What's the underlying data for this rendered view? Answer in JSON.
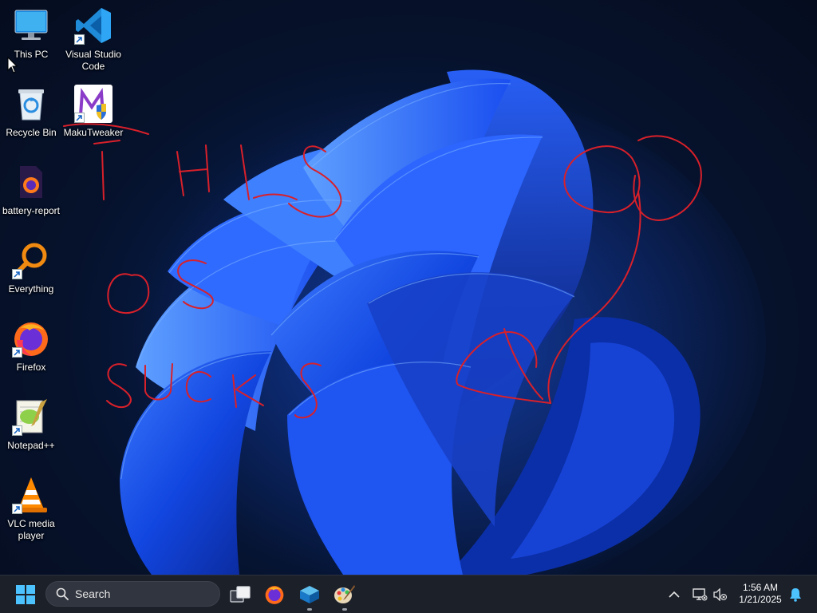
{
  "desktop": {
    "icons": [
      {
        "label": "This PC",
        "icon": "computer-icon"
      },
      {
        "label": "Visual Studio\nCode",
        "icon": "vscode-icon"
      },
      {
        "label": "Recycle Bin",
        "icon": "recycle-bin-icon"
      },
      {
        "label": "MakuTweaker",
        "icon": "makutweaker-icon"
      },
      {
        "label": "battery-report",
        "icon": "html-file-icon"
      },
      {
        "label": "Everything",
        "icon": "everything-search-icon"
      },
      {
        "label": "Firefox",
        "icon": "firefox-icon"
      },
      {
        "label": "Notepad++",
        "icon": "notepadpp-icon"
      },
      {
        "label": "VLC media\nplayer",
        "icon": "vlc-icon"
      }
    ],
    "wallpaper": "windows-11-bloom-blue",
    "scribble_color": "#d8202a"
  },
  "taskbar": {
    "search_placeholder": "Search",
    "pinned": [
      "start-icon",
      "search-icon",
      "task-view-icon",
      "firefox-icon",
      "virtualbox-icon",
      "paint-icon"
    ],
    "tray": [
      "chevron-up-icon",
      "network-icon",
      "volume-muted-icon",
      "notification-bell-icon"
    ],
    "time": "1:56 AM",
    "date": "1/21/2025"
  }
}
